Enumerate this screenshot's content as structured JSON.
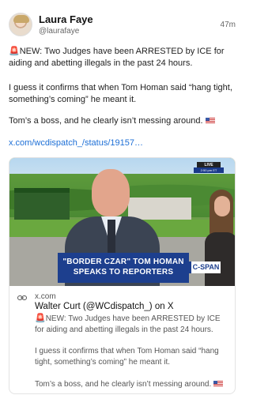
{
  "author": {
    "display_name": "Laura Faye",
    "handle": "@laurafaye",
    "timestamp": "47m",
    "avatar_icon": "profile-photo"
  },
  "post": {
    "siren": "🚨",
    "line1_rest": "NEW: Two Judges have been ARRESTED by ICE for aiding and abetting illegals in the past 24 hours.",
    "line2": "I guess it confirms that when Tom Homan said “hang tight, something’s coming” he meant it.",
    "line3": "Tom’s a boss, and he clearly isn’t messing around.",
    "flag_icon": "us-flag",
    "link": "x.com/wcdispatch_/status/19157…"
  },
  "card": {
    "media": {
      "live_label": "LIVE",
      "live_time": "2:50 pm ET",
      "chyron_line1": "\"BORDER CZAR\" TOM HOMAN",
      "chyron_line2": "SPEAKS TO REPORTERS",
      "network": "C-SPAN"
    },
    "domain": "x.com",
    "title": "Walter Curt (@WCdispatch_) on X",
    "text1_rest": "NEW: Two Judges have been ARRESTED by ICE for aiding and abetting illegals in the past 24 hours.",
    "text2": "I guess it confirms that when Tom Homan said “hang tight, something’s coming” he meant it.",
    "text3": "Tom’s a boss, and he clearly isn’t messing around."
  },
  "colors": {
    "link": "#1d6fd6",
    "chyron": "#1d3f8e",
    "siren": "#e0342a"
  }
}
